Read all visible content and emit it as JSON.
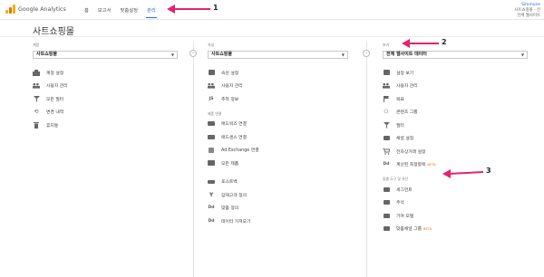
{
  "header": {
    "logo_text": "Google Analytics",
    "nav": [
      {
        "label": "홈"
      },
      {
        "label": "보고서"
      },
      {
        "label": "맞춤설정"
      },
      {
        "label": "관리"
      }
    ],
    "account": {
      "email": "Simmune",
      "line2": "사트쇼핑몰 - 전",
      "line3": "전체 웹사이트"
    }
  },
  "page_title": "사트쇼핑몰",
  "account_col": {
    "label": "계정",
    "selected": "사트쇼핑몰",
    "items": [
      {
        "label": "계정 설정",
        "icon": "building-icon"
      },
      {
        "label": "사용자 관리",
        "icon": "users-icon"
      },
      {
        "label": "모든 필터",
        "icon": "filter-icon"
      },
      {
        "label": "변경 내역",
        "icon": "history-icon"
      },
      {
        "label": "휴지통",
        "icon": "trash-icon"
      }
    ]
  },
  "property_col": {
    "label": "속성",
    "selected": "사트쇼핑몰",
    "items": [
      {
        "label": "속성 설정",
        "icon": "settings-square-icon"
      },
      {
        "label": "사용자 관리",
        "icon": "users-icon"
      },
      {
        "label": "추적 정보",
        "icon": "js-icon"
      }
    ],
    "section": "제품 연결",
    "section_items": [
      {
        "label": "애드워즈 연결",
        "icon": "adwords-icon"
      },
      {
        "label": "애드센스 연결",
        "icon": "adsense-icon"
      },
      {
        "label": "Ad Exchange 연결",
        "icon": "adexchange-icon"
      },
      {
        "label": "모든 제품",
        "icon": "products-icon"
      }
    ],
    "more_items": [
      {
        "label": "포스트백",
        "icon": "postback-icon"
      },
      {
        "label": "잠재고객 정의",
        "icon": "audience-icon"
      },
      {
        "label": "맞춤 정의",
        "icon": "dd-icon"
      },
      {
        "label": "데이터 가져오기",
        "icon": "dd-icon"
      }
    ]
  },
  "view_col": {
    "label": "보기",
    "selected": "전체 웹사이트 데이터",
    "items": [
      {
        "label": "설정 보기",
        "icon": "view-icon"
      },
      {
        "label": "사용자 관리",
        "icon": "users-icon"
      },
      {
        "label": "목표",
        "icon": "flag-icon"
      },
      {
        "label": "콘텐츠 그룹",
        "icon": "content-icon"
      },
      {
        "label": "필터",
        "icon": "filter-icon"
      },
      {
        "label": "채널 설정",
        "icon": "channel-icon"
      },
      {
        "label": "전자상거래 설정",
        "icon": "cart-icon"
      },
      {
        "label": "계산된 측정항목",
        "icon": "dd-icon",
        "badge": "BETA"
      }
    ],
    "section": "맞춤 도구 및 자산",
    "section_items": [
      {
        "label": "세그먼트",
        "icon": "segment-icon"
      },
      {
        "label": "주석",
        "icon": "annotation-icon"
      },
      {
        "label": "기여 모델",
        "icon": "attribution-icon"
      },
      {
        "label": "맞춤채널 그룹",
        "icon": "channel-icon",
        "badge": "BETA"
      }
    ]
  },
  "annotations": [
    "1",
    "2",
    "3"
  ],
  "colors": {
    "accent": "#3367d6",
    "arrow": "#e6226e",
    "beta": "#e8710a"
  }
}
